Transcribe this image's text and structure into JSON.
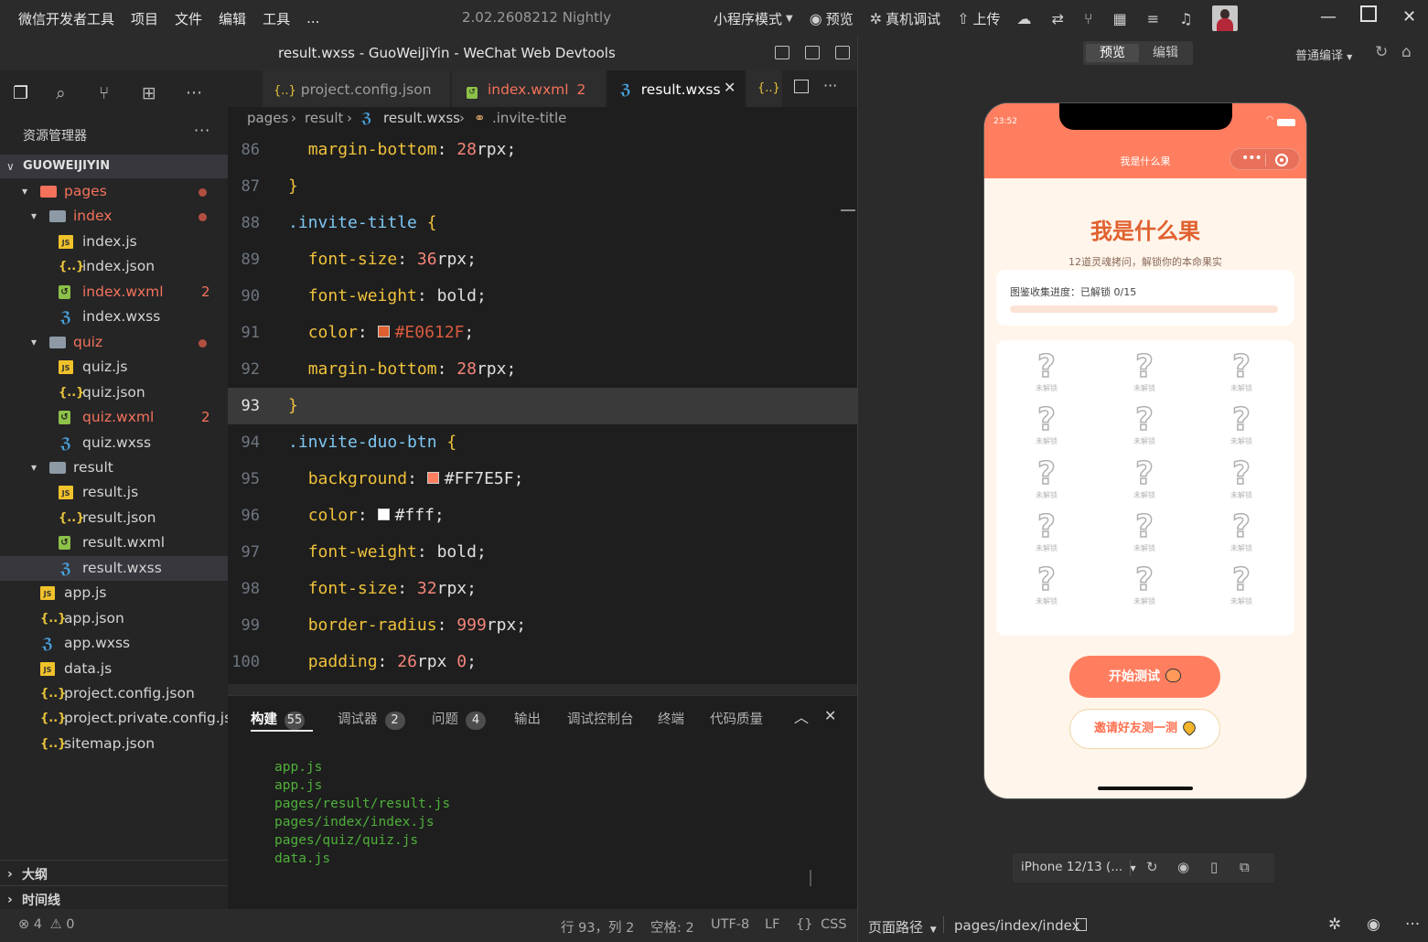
{
  "topbar": {
    "menu": [
      "微信开发者工具",
      "项目",
      "文件",
      "编辑",
      "工具",
      "..."
    ],
    "version": "2.02.2608212 Nightly",
    "mode_label": "小程序模式",
    "preview_label": "预览",
    "real_device_label": "真机调试",
    "upload_label": "上传"
  },
  "window": {
    "title": "result.wxss - GuoWeiJiYin - WeChat Web Devtools"
  },
  "explorer": {
    "title": "资源管理器",
    "more": "···",
    "root": "GUOWEIJIYIN",
    "items": [
      {
        "label": "pages",
        "type": "folder",
        "red": true,
        "dot": true
      },
      {
        "label": "index",
        "type": "folder",
        "red": true,
        "dot": true
      },
      {
        "label": "index.js",
        "type": "js"
      },
      {
        "label": "index.json",
        "type": "json"
      },
      {
        "label": "index.wxml",
        "type": "wxml",
        "red": true,
        "badge": "2"
      },
      {
        "label": "index.wxss",
        "type": "wxss"
      },
      {
        "label": "quiz",
        "type": "folder",
        "red": true,
        "dot": true
      },
      {
        "label": "quiz.js",
        "type": "js"
      },
      {
        "label": "quiz.json",
        "type": "json"
      },
      {
        "label": "quiz.wxml",
        "type": "wxml",
        "red": true,
        "badge": "2"
      },
      {
        "label": "quiz.wxss",
        "type": "wxss"
      },
      {
        "label": "result",
        "type": "folder"
      },
      {
        "label": "result.js",
        "type": "js"
      },
      {
        "label": "result.json",
        "type": "json"
      },
      {
        "label": "result.wxml",
        "type": "wxml"
      },
      {
        "label": "result.wxss",
        "type": "wxss",
        "selected": true
      },
      {
        "label": "app.js",
        "type": "js"
      },
      {
        "label": "app.json",
        "type": "json"
      },
      {
        "label": "app.wxss",
        "type": "wxss"
      },
      {
        "label": "data.js",
        "type": "js"
      },
      {
        "label": "project.config.json",
        "type": "json"
      },
      {
        "label": "project.private.config.js...",
        "type": "json"
      },
      {
        "label": "sitemap.json",
        "type": "json"
      }
    ],
    "outline_label": "大纲",
    "timeline_label": "时间线"
  },
  "tabs": [
    {
      "label": "project.config.json",
      "icon": "{..}"
    },
    {
      "label": "index.wxml",
      "badge": "2",
      "icon": "wxml"
    },
    {
      "label": "result.wxss",
      "active": true,
      "icon": "wxss"
    },
    {
      "label": "{..}",
      "icon": ""
    }
  ],
  "breadcrumb": {
    "parts": [
      "pages",
      "result",
      "result.wxss",
      ".invite-title"
    ]
  },
  "editor": {
    "current_line": 93,
    "lines": [
      {
        "n": "86",
        "indent": 1,
        "prop": "margin-bottom",
        "num": "28",
        "unit": "rpx"
      },
      {
        "n": "87",
        "brace": "}"
      },
      {
        "n": "88",
        "selector": ".invite-title",
        "open": true
      },
      {
        "n": "89",
        "indent": 1,
        "prop": "font-size",
        "num": "36",
        "unit": "rpx"
      },
      {
        "n": "90",
        "indent": 1,
        "prop": "font-weight",
        "kw": "bold"
      },
      {
        "n": "91",
        "indent": 1,
        "prop": "color",
        "color": "#E0612F"
      },
      {
        "n": "92",
        "indent": 1,
        "prop": "margin-bottom",
        "num": "28",
        "unit": "rpx"
      },
      {
        "n": "93",
        "brace": "}"
      },
      {
        "n": "94",
        "selector": ".invite-duo-btn",
        "open": true
      },
      {
        "n": "95",
        "indent": 1,
        "prop": "background",
        "color": "#FF7E5F"
      },
      {
        "n": "96",
        "indent": 1,
        "prop": "color",
        "color": "#fff"
      },
      {
        "n": "97",
        "indent": 1,
        "prop": "font-weight",
        "kw": "bold"
      },
      {
        "n": "98",
        "indent": 1,
        "prop": "font-size",
        "num": "32",
        "unit": "rpx"
      },
      {
        "n": "99",
        "indent": 1,
        "prop": "border-radius",
        "num": "999",
        "unit": "rpx"
      },
      {
        "n": "100",
        "indent": 1,
        "prop": "padding",
        "num": "26",
        "unit": "rpx",
        "extra": "0"
      }
    ]
  },
  "panel": {
    "tabs": [
      {
        "label": "构建",
        "badge": "55",
        "active": true
      },
      {
        "label": "调试器",
        "badge": "2"
      },
      {
        "label": "问题",
        "badge": "4"
      },
      {
        "label": "输出"
      },
      {
        "label": "调试控制台"
      },
      {
        "label": "终端"
      },
      {
        "label": "代码质量"
      }
    ],
    "logs": [
      "app.js",
      "app.js",
      "pages/result/result.js",
      "pages/index/index.js",
      "pages/quiz/quiz.js",
      "data.js"
    ]
  },
  "status": {
    "errors": "4",
    "warnings": "0",
    "position": "行 93，列 2",
    "spaces": "空格: 2",
    "encoding": "UTF-8",
    "eol": "LF",
    "language": "CSS"
  },
  "simulator": {
    "seg_preview": "预览",
    "seg_edit": "编辑",
    "compile_mode": "普通编译",
    "phone": {
      "time": "23:52",
      "nav_title": "我是什么果",
      "heading": "我是什么果",
      "subtitle": "12道灵魂拷问，解锁你的本命果实",
      "progress_text": "图鉴收集进度：已解锁 0/15",
      "progress_fraction": 0,
      "cell_label": "未解锁",
      "cell_count": 15,
      "start_button": "开始测试",
      "invite_button": "邀请好友测一测"
    },
    "device": "iPhone 12/13 (...",
    "page_path_label": "页面路径",
    "page_path": "pages/index/index"
  },
  "colors": {
    "accent": "#FF7E5F",
    "title_color": "#E0612F",
    "log_green": "#4fb03b",
    "error_red": "#f4725b"
  }
}
